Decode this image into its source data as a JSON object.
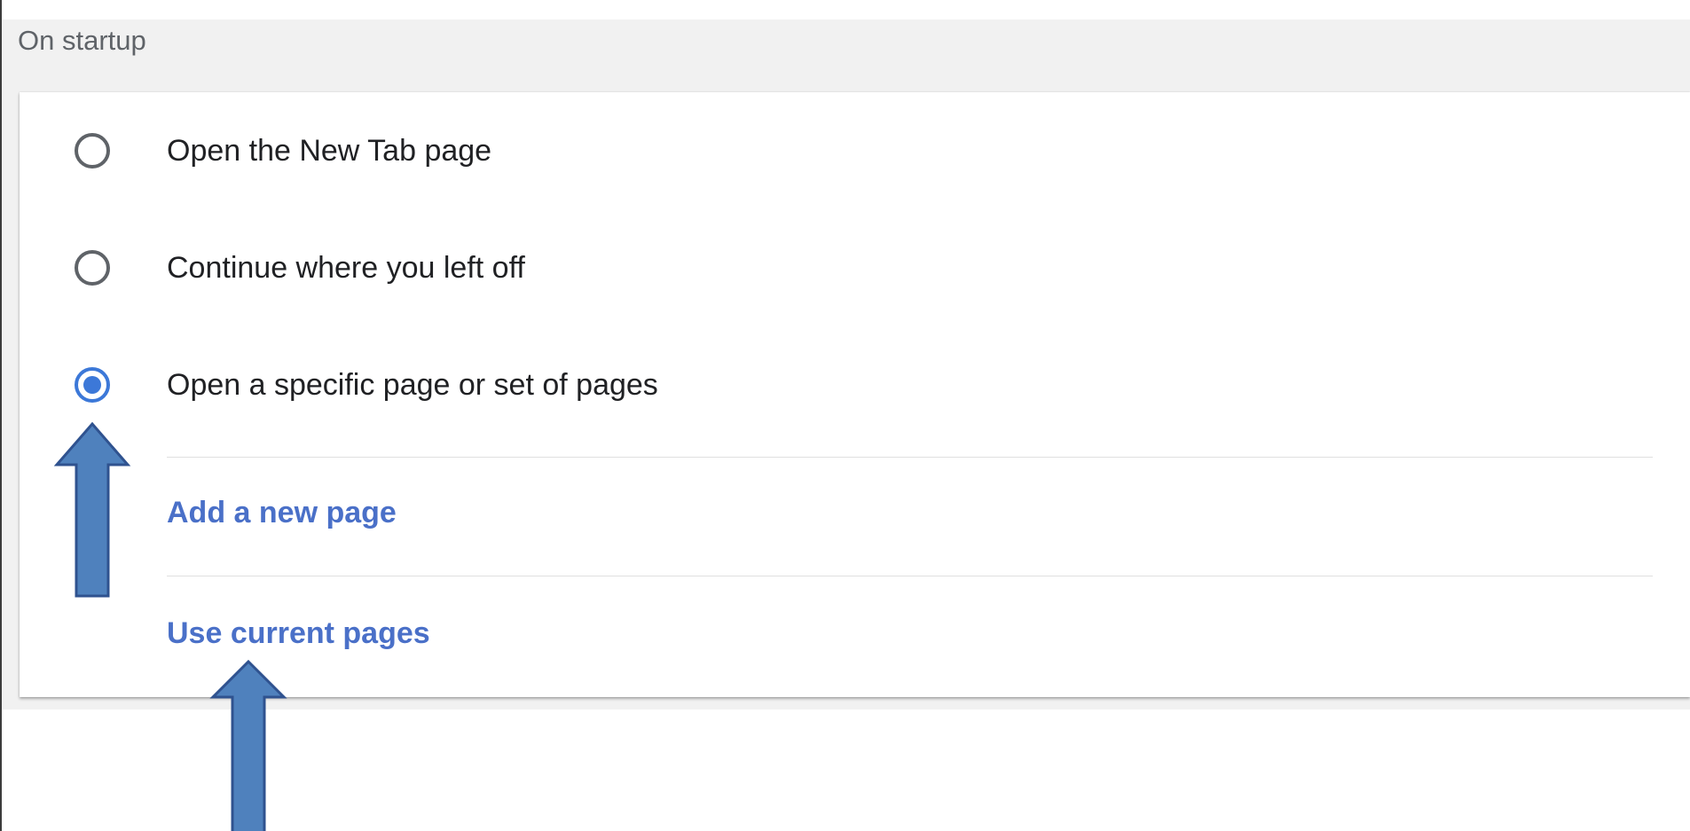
{
  "section": {
    "title": "On startup"
  },
  "startup_options": [
    {
      "label": "Open the New Tab page",
      "selected": false
    },
    {
      "label": "Continue where you left off",
      "selected": false
    },
    {
      "label": "Open a specific page or set of pages",
      "selected": true
    }
  ],
  "links": {
    "add_page": "Add a new page",
    "use_current": "Use current pages"
  },
  "colors": {
    "accent": "#3c78d8",
    "link": "#4a70c8",
    "annotation_arrow_fill": "#4f81bd",
    "annotation_arrow_stroke": "#2f528f"
  },
  "annotations": [
    {
      "type": "arrow-up",
      "points_to": "Open a specific page or set of pages"
    },
    {
      "type": "arrow-up",
      "points_to": "Use current pages"
    }
  ]
}
